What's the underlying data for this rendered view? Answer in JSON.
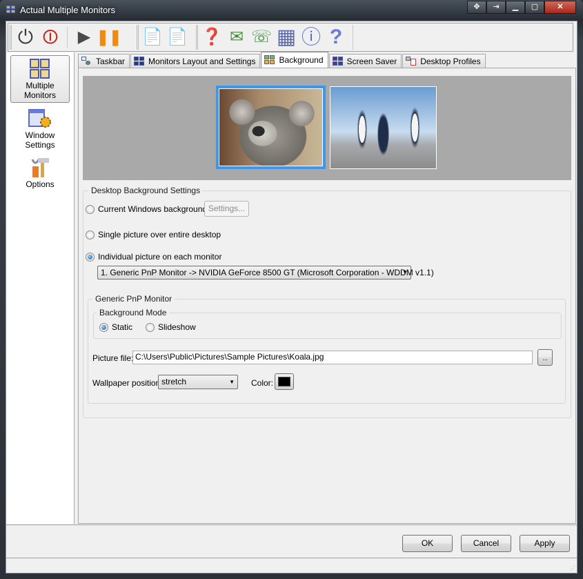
{
  "window": {
    "title": "Actual Multiple Monitors",
    "title_buttons": [
      {
        "name": "move-icon",
        "glyph": "✥"
      },
      {
        "name": "pin-icon",
        "glyph": "⇥"
      },
      {
        "name": "minimize-icon",
        "glyph": "▁"
      },
      {
        "name": "maximize-icon",
        "glyph": "▢"
      },
      {
        "name": "close-icon",
        "glyph": "✕"
      }
    ]
  },
  "toolbar": {
    "groups": [
      [
        {
          "name": "power-icon",
          "glyph": "⏻",
          "color": "#3a3a3a"
        },
        {
          "name": "shutdown-icon",
          "glyph": "⏼",
          "color": "#c8281e"
        },
        {
          "sep": true
        },
        {
          "name": "play-icon",
          "glyph": "▶",
          "color": "#4a4a4a"
        },
        {
          "name": "pause-icon",
          "glyph": "❚❚",
          "color": "#f08a10"
        }
      ],
      [
        {
          "name": "user-settings-icon",
          "glyph": "📄",
          "color": "#5a7ac8"
        },
        {
          "name": "admin-settings-icon",
          "glyph": "📄",
          "color": "#5a7ac8"
        }
      ],
      [
        {
          "name": "help-doc-icon",
          "glyph": "❓",
          "color": "#e89a10"
        },
        {
          "name": "email-icon",
          "glyph": "✉",
          "color": "#4a8a3a"
        },
        {
          "name": "support-icon",
          "glyph": "☏",
          "color": "#3a8a3a"
        },
        {
          "name": "monitors-icon",
          "glyph": "▦",
          "color": "#5a6aa8"
        },
        {
          "name": "about-icon",
          "glyph": "ⓘ",
          "color": "#5a6ac8"
        },
        {
          "name": "help-icon",
          "glyph": "?",
          "color": "#6a7ad8"
        }
      ]
    ]
  },
  "sidebar": {
    "items": [
      {
        "label": "Multiple Monitors",
        "active": true
      },
      {
        "label": "Window Settings",
        "active": false
      },
      {
        "label": "Options",
        "active": false
      }
    ]
  },
  "tabs": [
    {
      "label": "Taskbar",
      "active": false
    },
    {
      "label": "Monitors Layout and Settings",
      "active": false
    },
    {
      "label": "Background",
      "active": true
    },
    {
      "label": "Screen Saver",
      "active": false
    },
    {
      "label": "Desktop Profiles",
      "active": false
    }
  ],
  "preview": {
    "monitors": [
      {
        "label": "Koala",
        "selected": true
      },
      {
        "label": "Penguins",
        "selected": false
      }
    ],
    "selection_color": "#3a98f0"
  },
  "settings": {
    "group_label": "Desktop Background Settings",
    "options": [
      {
        "label": "Current Windows background",
        "checked": false
      },
      {
        "label": "Single picture over entire desktop",
        "checked": false
      },
      {
        "label": "Individual picture on each monitor",
        "checked": true
      }
    ],
    "settings_button": "Settings...",
    "monitor_select": "1. Generic PnP Monitor -> NVIDIA GeForce 8500 GT (Microsoft Corporation - WDDM v1.1)",
    "monitor_group_label": "Generic PnP Monitor",
    "mode_group_label": "Background Mode",
    "modes": [
      {
        "label": "Static",
        "checked": true
      },
      {
        "label": "Slideshow",
        "checked": false
      }
    ],
    "picture_file_label": "Picture file:",
    "picture_file_value": "C:\\Users\\Public\\Pictures\\Sample Pictures\\Koala.jpg",
    "browse_button": "...",
    "wallpaper_position_label": "Wallpaper position:",
    "wallpaper_position_value": "stretch",
    "color_label": "Color:",
    "color_value": "#000000"
  },
  "footer": {
    "ok": "OK",
    "cancel": "Cancel",
    "apply": "Apply"
  }
}
